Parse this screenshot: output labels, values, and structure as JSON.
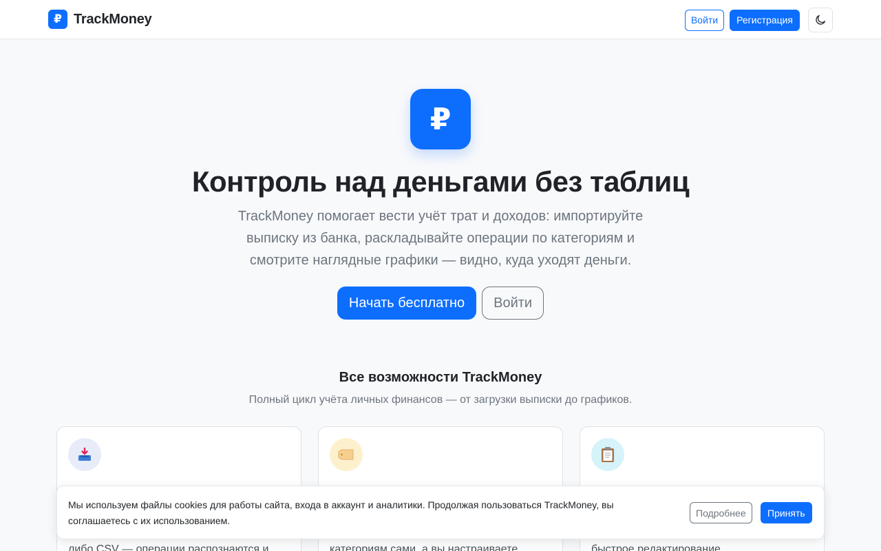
{
  "brand": {
    "logo_glyph": "₽",
    "name": "TrackMoney",
    "accent": "#0d6efd"
  },
  "nav": {
    "login_label": "Войти",
    "register_label": "Регистрация",
    "theme_icon": "moon-icon"
  },
  "hero": {
    "icon_glyph": "₽",
    "title": "Контроль над деньгами без таблиц",
    "lead_lines": [
      "TrackMoney помогает вести учёт трат и доходов: импортируйте",
      "выписку из банка, раскладывайте операции по категориям и",
      "смотрите наглядные графики — видно, куда уходят деньги."
    ],
    "primary_cta": "Начать бесплатно",
    "secondary_cta": "Войти"
  },
  "features": {
    "title": "Все возможности TrackMoney",
    "subtitle": "Полный цикл учёта личных финансов — от загрузки выписки до графиков.",
    "cards": [
      {
        "icon": "inbox-tray-icon",
        "icon_bg": "#e7ecf8",
        "partial_text": "либо CSV — операции распознаются и"
      },
      {
        "icon": "tag-icon",
        "icon_bg": "#fdf0cc",
        "partial_text": "категориям сами, а вы настраиваете"
      },
      {
        "icon": "clipboard-icon",
        "icon_bg": "#d6f3fa",
        "partial_text": "быстрое редактирование"
      }
    ]
  },
  "cookie": {
    "text": "Мы используем файлы cookies для работы сайта, входа в аккаунт и аналитики. Продолжая пользоваться TrackMoney, вы соглашаетесь с их использованием.",
    "more_label": "Подробнее",
    "accept_label": "Принять"
  }
}
